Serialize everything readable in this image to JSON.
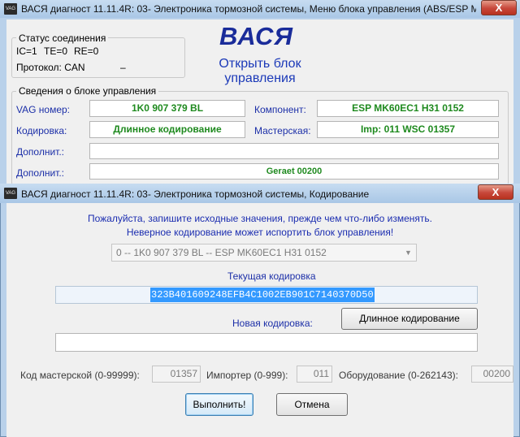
{
  "main_window": {
    "title": "ВАСЯ диагност 11.11.4R: 03- Электроника тормозной системы,  Меню блока управления (ABS/ESP M...",
    "close_label": "X",
    "app_icon_text": "VAG",
    "status_group": {
      "title": "Статус соединения",
      "ic": "IC=1",
      "te": "TE=0",
      "re": "RE=0",
      "protocol_label": "Протокол: CAN",
      "protocol_value": "–"
    },
    "brand": "ВАСЯ",
    "open_block": "Открыть блок управления",
    "info_group": {
      "title": "Сведения о блоке управления",
      "vag_label": "VAG номер:",
      "vag_value": "1K0 907 379 BL",
      "component_label": "Компонент:",
      "component_value": "ESP MK60EC1    H31 0152",
      "coding_label": "Кодировка:",
      "coding_value": "Длинное кодирование",
      "workshop_label": "Мастерская:",
      "workshop_value": "Imp: 011     WSC 01357",
      "extra1_label": "Дополнит.:",
      "extra1_value": "",
      "extra2_label": "Дополнит.:",
      "extra2_value": "Geraet 00200"
    }
  },
  "dialog": {
    "title": "ВАСЯ диагност 11.11.4R: 03- Электроника тормозной системы,  Кодирование",
    "close_label": "X",
    "app_icon_text": "VAG",
    "warning_line1": "Пожалуйста, запишите исходные значения, прежде чем что-либо изменять.",
    "warning_line2": "Неверное кодирование может испортить блок управления!",
    "module_select": "0 -- 1K0 907 379 BL -- ESP MK60EC1    H31 0152",
    "current_coding_label": "Текущая кодировка",
    "current_coding_value": "323B401609248EFB4C1002EB901C7140370D50",
    "long_coding_button": "Длинное кодирование",
    "new_coding_label": "Новая кодировка:",
    "new_coding_value": "",
    "workshop_label": "Код мастерской (0-99999):",
    "workshop_value": "01357",
    "importer_label": "Импортер (0-999):",
    "importer_value": "011",
    "equipment_label": "Оборудование (0-262143):",
    "equipment_value": "00200",
    "execute_button": "Выполнить!",
    "cancel_button": "Отмена"
  },
  "colors": {
    "title_bar": "#a9c7e6",
    "brand_blue": "#1a2c9a",
    "label_blue": "#1c2fa8",
    "value_green": "#1f8a1f",
    "selection_blue": "#3399ff",
    "close_red": "#c7473a"
  }
}
